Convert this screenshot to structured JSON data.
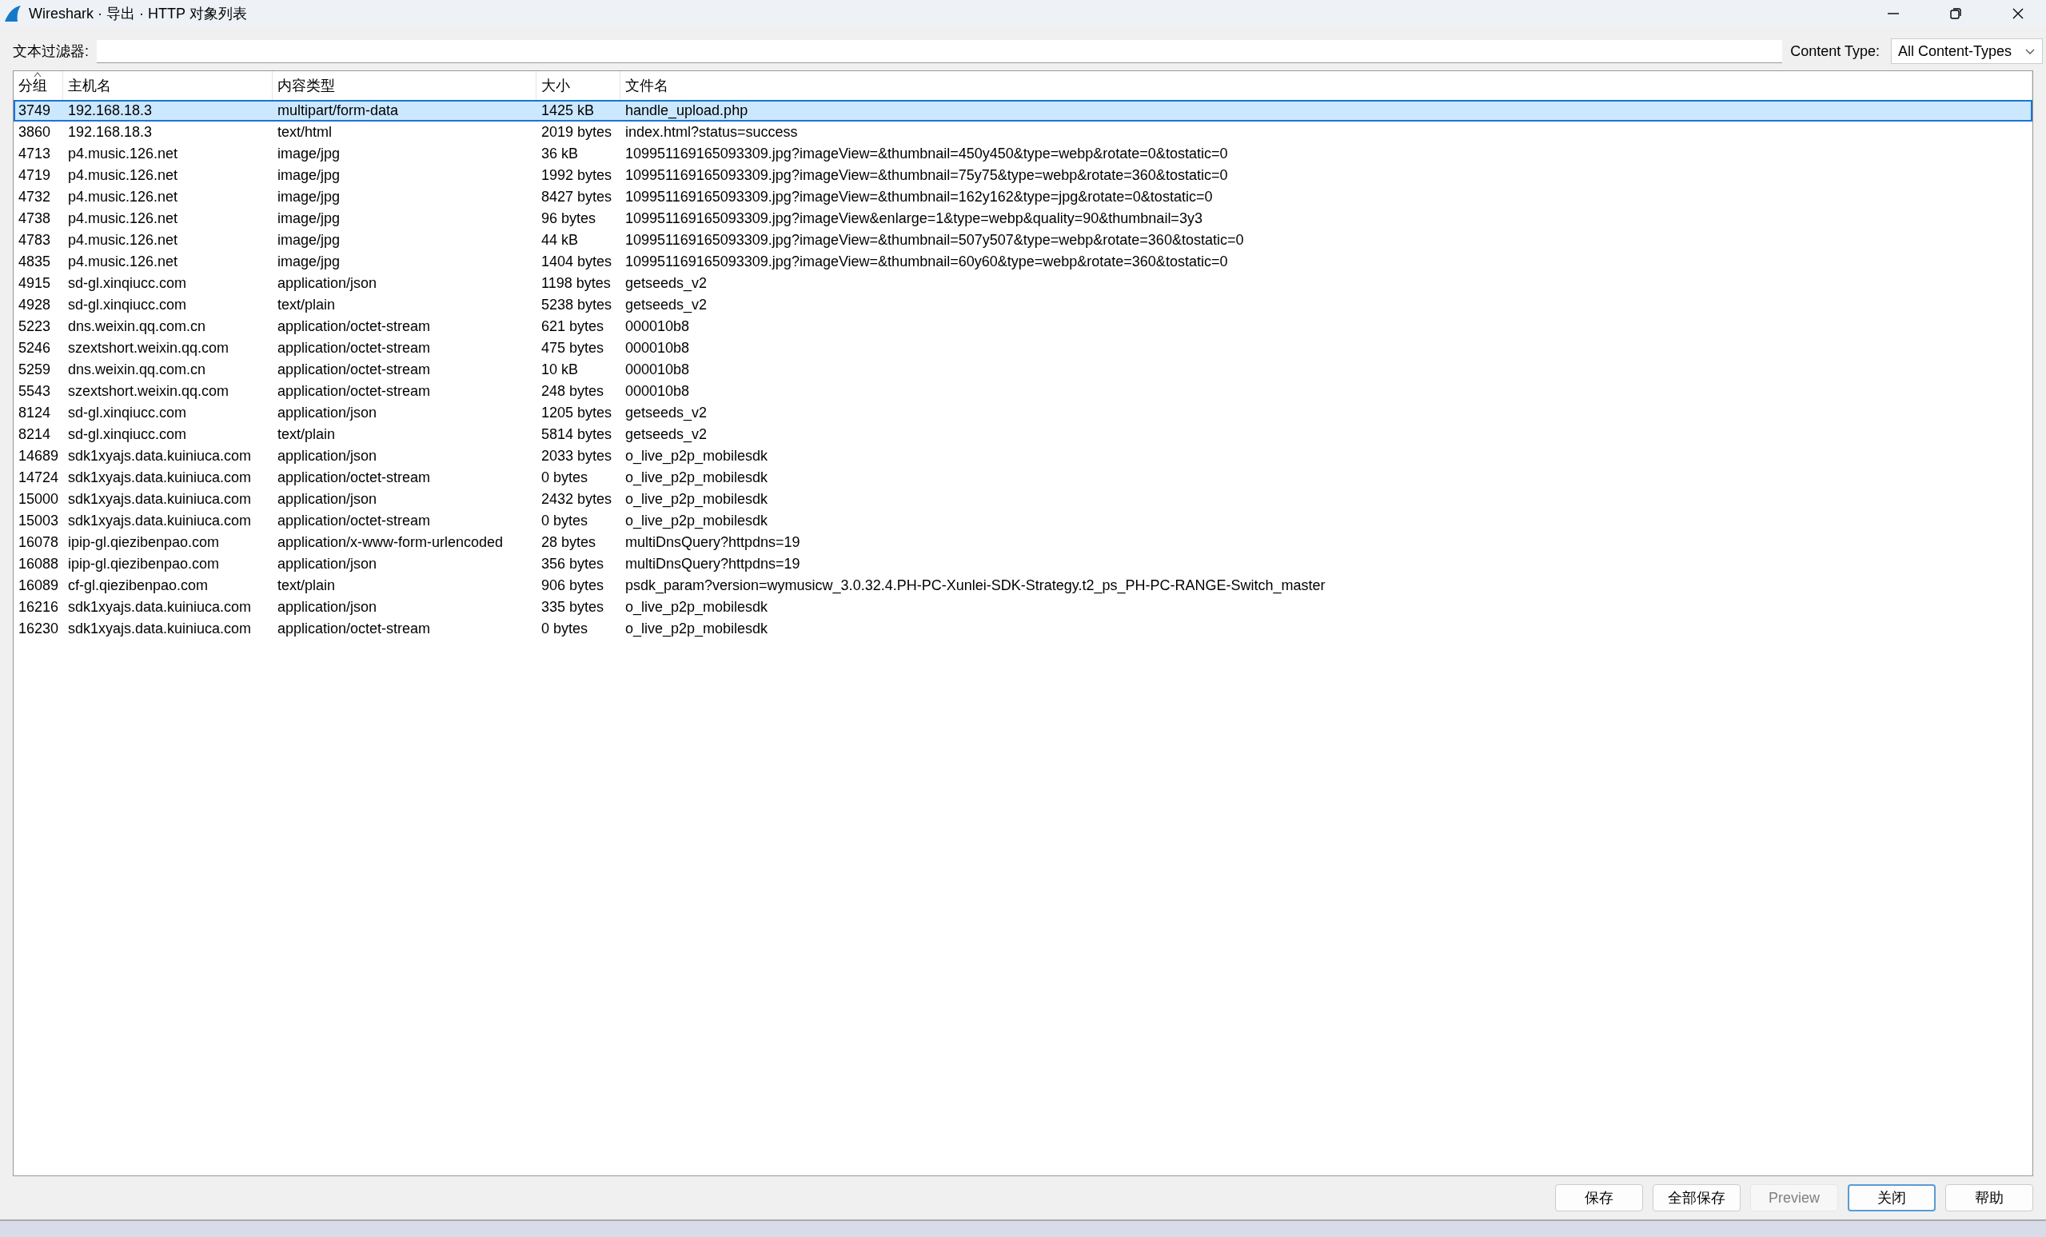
{
  "window": {
    "title": "Wireshark · 导出 · HTTP 对象列表"
  },
  "filter": {
    "label": "文本过滤器:"
  },
  "content_type": {
    "label": "Content Type:",
    "value": "All Content-Types"
  },
  "table": {
    "columns": [
      {
        "label": "分组",
        "sorted": true
      },
      {
        "label": "主机名",
        "sorted": false
      },
      {
        "label": "内容类型",
        "sorted": false
      },
      {
        "label": "大小",
        "sorted": false
      },
      {
        "label": "文件名",
        "sorted": false
      }
    ],
    "rows": [
      {
        "cells": [
          "3749",
          "192.168.18.3",
          "multipart/form-data",
          "1425 kB",
          "handle_upload.php"
        ],
        "selected": true
      },
      {
        "cells": [
          "3860",
          "192.168.18.3",
          "text/html",
          "2019 bytes",
          "index.html?status=success"
        ],
        "selected": false
      },
      {
        "cells": [
          "4713",
          "p4.music.126.net",
          "image/jpg",
          "36 kB",
          "109951169165093309.jpg?imageView=&thumbnail=450y450&type=webp&rotate=0&tostatic=0"
        ],
        "selected": false
      },
      {
        "cells": [
          "4719",
          "p4.music.126.net",
          "image/jpg",
          "1992 bytes",
          "109951169165093309.jpg?imageView=&thumbnail=75y75&type=webp&rotate=360&tostatic=0"
        ],
        "selected": false
      },
      {
        "cells": [
          "4732",
          "p4.music.126.net",
          "image/jpg",
          "8427 bytes",
          "109951169165093309.jpg?imageView=&thumbnail=162y162&type=jpg&rotate=0&tostatic=0"
        ],
        "selected": false
      },
      {
        "cells": [
          "4738",
          "p4.music.126.net",
          "image/jpg",
          "96 bytes",
          "109951169165093309.jpg?imageView&enlarge=1&type=webp&quality=90&thumbnail=3y3"
        ],
        "selected": false
      },
      {
        "cells": [
          "4783",
          "p4.music.126.net",
          "image/jpg",
          "44 kB",
          "109951169165093309.jpg?imageView=&thumbnail=507y507&type=webp&rotate=360&tostatic=0"
        ],
        "selected": false
      },
      {
        "cells": [
          "4835",
          "p4.music.126.net",
          "image/jpg",
          "1404 bytes",
          "109951169165093309.jpg?imageView=&thumbnail=60y60&type=webp&rotate=360&tostatic=0"
        ],
        "selected": false
      },
      {
        "cells": [
          "4915",
          "sd-gl.xinqiucc.com",
          "application/json",
          "1198 bytes",
          "getseeds_v2"
        ],
        "selected": false
      },
      {
        "cells": [
          "4928",
          "sd-gl.xinqiucc.com",
          "text/plain",
          "5238 bytes",
          "getseeds_v2"
        ],
        "selected": false
      },
      {
        "cells": [
          "5223",
          "dns.weixin.qq.com.cn",
          "application/octet-stream",
          "621 bytes",
          "000010b8"
        ],
        "selected": false
      },
      {
        "cells": [
          "5246",
          "szextshort.weixin.qq.com",
          "application/octet-stream",
          "475 bytes",
          "000010b8"
        ],
        "selected": false
      },
      {
        "cells": [
          "5259",
          "dns.weixin.qq.com.cn",
          "application/octet-stream",
          "10 kB",
          "000010b8"
        ],
        "selected": false
      },
      {
        "cells": [
          "5543",
          "szextshort.weixin.qq.com",
          "application/octet-stream",
          "248 bytes",
          "000010b8"
        ],
        "selected": false
      },
      {
        "cells": [
          "8124",
          "sd-gl.xinqiucc.com",
          "application/json",
          "1205 bytes",
          "getseeds_v2"
        ],
        "selected": false
      },
      {
        "cells": [
          "8214",
          "sd-gl.xinqiucc.com",
          "text/plain",
          "5814 bytes",
          "getseeds_v2"
        ],
        "selected": false
      },
      {
        "cells": [
          "14689",
          "sdk1xyajs.data.kuiniuca.com",
          "application/json",
          "2033 bytes",
          "o_live_p2p_mobilesdk"
        ],
        "selected": false
      },
      {
        "cells": [
          "14724",
          "sdk1xyajs.data.kuiniuca.com",
          "application/octet-stream",
          "0 bytes",
          "o_live_p2p_mobilesdk"
        ],
        "selected": false
      },
      {
        "cells": [
          "15000",
          "sdk1xyajs.data.kuiniuca.com",
          "application/json",
          "2432 bytes",
          "o_live_p2p_mobilesdk"
        ],
        "selected": false
      },
      {
        "cells": [
          "15003",
          "sdk1xyajs.data.kuiniuca.com",
          "application/octet-stream",
          "0 bytes",
          "o_live_p2p_mobilesdk"
        ],
        "selected": false
      },
      {
        "cells": [
          "16078",
          "ipip-gl.qiezibenpao.com",
          "application/x-www-form-urlencoded",
          "28 bytes",
          "multiDnsQuery?httpdns=19"
        ],
        "selected": false
      },
      {
        "cells": [
          "16088",
          "ipip-gl.qiezibenpao.com",
          "application/json",
          "356 bytes",
          "multiDnsQuery?httpdns=19"
        ],
        "selected": false
      },
      {
        "cells": [
          "16089",
          "cf-gl.qiezibenpao.com",
          "text/plain",
          "906 bytes",
          "psdk_param?version=wymusicw_3.0.32.4.PH-PC-Xunlei-SDK-Strategy.t2_ps_PH-PC-RANGE-Switch_master"
        ],
        "selected": false
      },
      {
        "cells": [
          "16216",
          "sdk1xyajs.data.kuiniuca.com",
          "application/json",
          "335 bytes",
          "o_live_p2p_mobilesdk"
        ],
        "selected": false
      },
      {
        "cells": [
          "16230",
          "sdk1xyajs.data.kuiniuca.com",
          "application/octet-stream",
          "0 bytes",
          "o_live_p2p_mobilesdk"
        ],
        "selected": false
      }
    ]
  },
  "buttons": [
    {
      "label": "保存",
      "disabled": false,
      "default": false
    },
    {
      "label": "全部保存",
      "disabled": false,
      "default": false
    },
    {
      "label": "Preview",
      "disabled": true,
      "default": false
    },
    {
      "label": "关闭",
      "disabled": false,
      "default": true
    },
    {
      "label": "帮助",
      "disabled": false,
      "default": false
    }
  ]
}
